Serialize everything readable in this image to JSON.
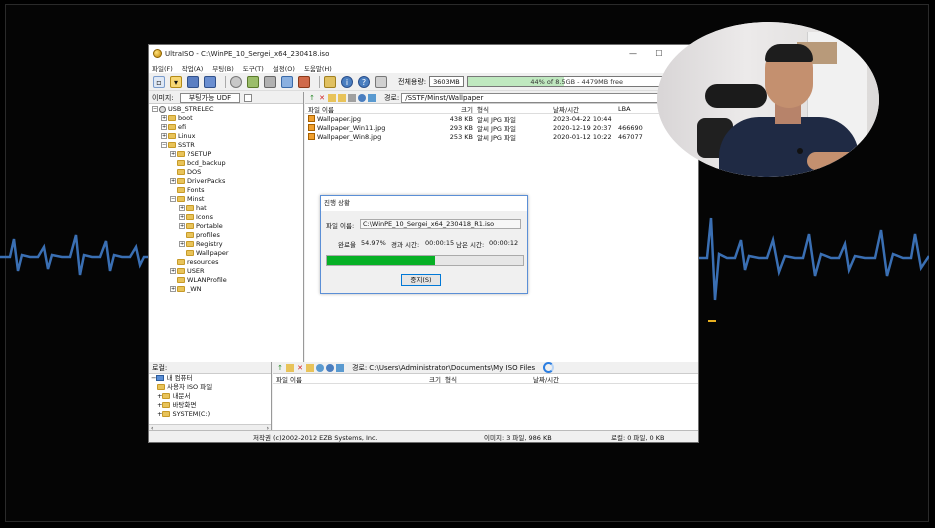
{
  "window": {
    "app_name": "UltraISO",
    "title": "UltraISO - C:\\WinPE_10_Sergei_x64_230418.iso",
    "controls": {
      "minimize": "—",
      "maximize": "☐",
      "close": "✕"
    }
  },
  "menu": [
    "파일(F)",
    "작업(A)",
    "부팅(B)",
    "도구(T)",
    "설정(O)",
    "도움말(H)"
  ],
  "toolbar": {
    "usage_label": "전체용량:",
    "usage_value": "3603MB",
    "usage_bar_text": "44% of 8.5GB - 4479MB free",
    "usage_fraction": 0.44
  },
  "image_pane": {
    "label": "이미지:",
    "format": "부팅가능 UDF",
    "path_label": "경로:",
    "path": "/SSTF/Minst/Wallpaper",
    "tree": [
      {
        "label": "USB_STRELEC",
        "level": 0,
        "exp": "-",
        "kind": "disc"
      },
      {
        "label": "boot",
        "level": 1,
        "exp": "+"
      },
      {
        "label": "efi",
        "level": 1,
        "exp": "+"
      },
      {
        "label": "Linux",
        "level": 1,
        "exp": "+"
      },
      {
        "label": "SSTR",
        "level": 1,
        "exp": "-"
      },
      {
        "label": "?SETUP",
        "level": 2,
        "exp": "+"
      },
      {
        "label": "bcd_backup",
        "level": 2,
        "exp": ""
      },
      {
        "label": "DOS",
        "level": 2,
        "exp": ""
      },
      {
        "label": "DriverPacks",
        "level": 2,
        "exp": "+"
      },
      {
        "label": "Fonts",
        "level": 2,
        "exp": ""
      },
      {
        "label": "Minst",
        "level": 2,
        "exp": "-"
      },
      {
        "label": "hat",
        "level": 3,
        "exp": "+"
      },
      {
        "label": "Icons",
        "level": 3,
        "exp": "+"
      },
      {
        "label": "Portable",
        "level": 3,
        "exp": "+"
      },
      {
        "label": "profiles",
        "level": 3,
        "exp": ""
      },
      {
        "label": "Registry",
        "level": 3,
        "exp": "+"
      },
      {
        "label": "Wallpaper",
        "level": 3,
        "exp": ""
      },
      {
        "label": "resources",
        "level": 2,
        "exp": ""
      },
      {
        "label": "USER",
        "level": 2,
        "exp": "+"
      },
      {
        "label": "WLANProfile",
        "level": 2,
        "exp": ""
      },
      {
        "label": "_WN",
        "level": 2,
        "exp": "+"
      }
    ],
    "columns": {
      "name": "파일 이름",
      "size": "크기",
      "type": "형식",
      "date": "날짜/시간",
      "lba": "LBA"
    },
    "files": [
      {
        "name": "Wallpaper.jpg",
        "size": "438 KB",
        "type": "알씨 JPG 파일",
        "date": "2023-04-22 10:44",
        "lba": ""
      },
      {
        "name": "Wallpaper_Win11.jpg",
        "size": "293 KB",
        "type": "알씨 JPG 파일",
        "date": "2020-12-19 20:37",
        "lba": "466690"
      },
      {
        "name": "Wallpaper_Win8.jpg",
        "size": "253 KB",
        "type": "알씨 JPG 파일",
        "date": "2020-01-12 10:22",
        "lba": "467077"
      }
    ]
  },
  "dialog": {
    "title": "진행 상황",
    "file_label": "파일 이름:",
    "file_value": "C:\\WinPE_10_Sergei_x64_230418_R1.iso",
    "completed_label": "완료율",
    "completed_value": "54.97%",
    "elapsed_label": "경과 시간:",
    "elapsed_value": "00:00:15",
    "remaining_label": "남은 시간:",
    "remaining_value": "00:00:12",
    "progress_fraction": 0.5497,
    "stop_button": "중지(S)"
  },
  "local_pane": {
    "label": "로컬:",
    "path_label": "경로:",
    "path": "C:\\Users\\Administrator\\Documents\\My ISO Files",
    "tree": [
      {
        "label": "내 컴퓨터",
        "exp": "-"
      },
      {
        "label": "사용자 ISO 파일",
        "exp": ""
      },
      {
        "label": "내문서",
        "exp": "+"
      },
      {
        "label": "바탕화면",
        "exp": "+"
      },
      {
        "label": "SYSTEM(C:)",
        "exp": "+"
      }
    ],
    "columns": {
      "name": "파일 이름",
      "size": "크기",
      "type": "형식",
      "date": "날짜/시간"
    }
  },
  "status": {
    "copyright": "저작권 (c)2002-2012 EZB Systems, Inc.",
    "image_info": "이미지: 3 파일, 986 KB",
    "local_info": "로컬: 0 파일, 0 KB"
  },
  "colors": {
    "pulse": "#3a6fb3",
    "progress": "#06b025",
    "usage": "#bfe8bf"
  }
}
